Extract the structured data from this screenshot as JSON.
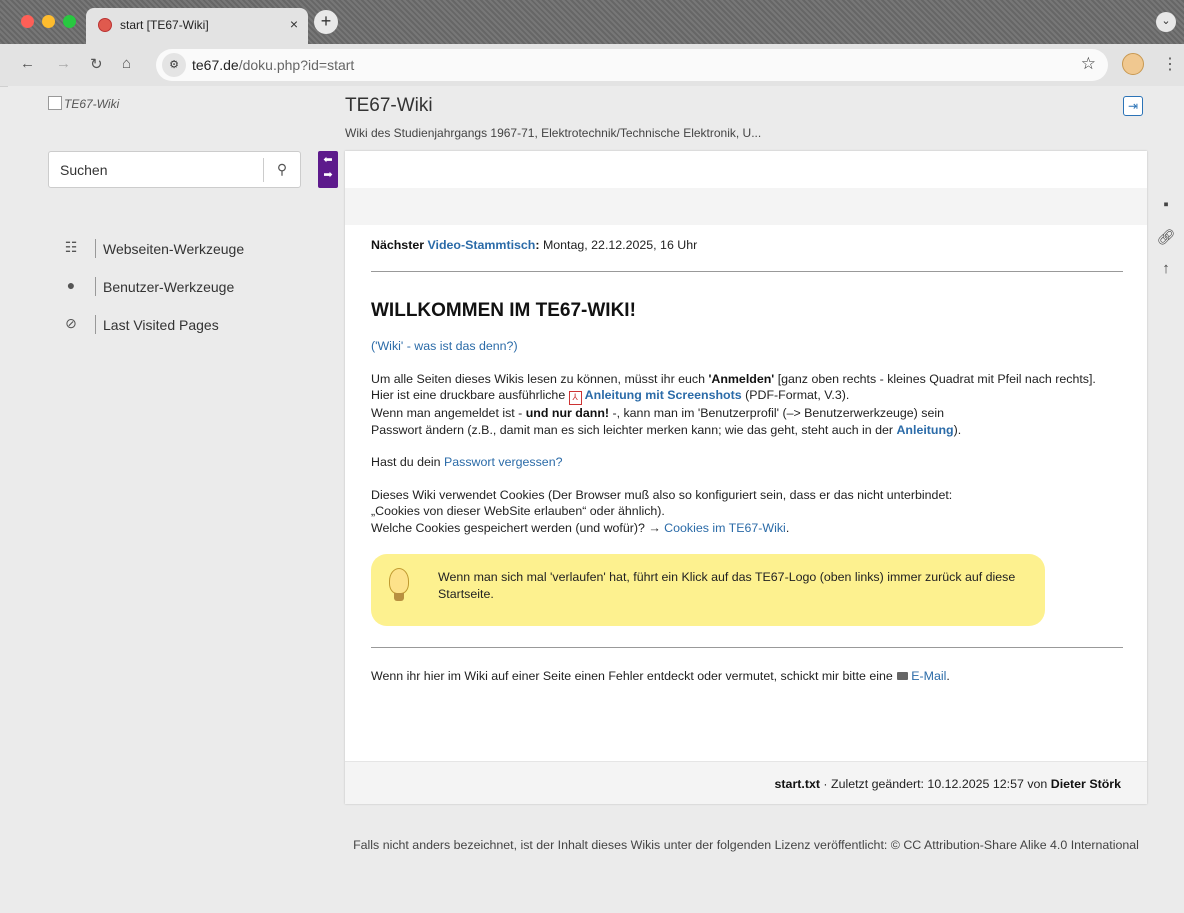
{
  "browser": {
    "tab_title": "start [TE67-Wiki]",
    "tab_close": "×",
    "new_tab": "+",
    "tab_menu": "⌄",
    "url_host": "te67.de",
    "url_path": "/doku.php?id=start"
  },
  "site": {
    "logo_alt": "TE67-Wiki",
    "title": "TE67-Wiki",
    "tagline": "Wiki des Studienjahrgangs 1967-71, Elektrotechnik/Technische Elektronik, U...",
    "search_placeholder": "Suchen"
  },
  "sidebar": {
    "items": [
      {
        "label": "Webseiten-Werkzeuge",
        "icon": "sitemap-icon"
      },
      {
        "label": "Benutzer-Werkzeuge",
        "icon": "user-icon"
      },
      {
        "label": "Last Visited Pages",
        "icon": "compass-icon"
      }
    ]
  },
  "content": {
    "next_label": "Nächster",
    "next_link": "Video-Stammtisch",
    "next_colon": ":",
    "next_date": " Montag, 22.12.2025, 16 Uhr",
    "heading": "WILLKOMMEN IM TE67-WIKI!",
    "wiki_link": "('Wiki' - was ist das denn?)",
    "p1_a": "Um alle Seiten dieses Wikis lesen zu können, müsst ihr euch ",
    "p1_b": "'Anmelden'",
    "p1_c": " [ganz oben rechts - kleines Quadrat mit Pfeil nach rechts].",
    "p2_a": "Hier ist eine druckbare ausführliche ",
    "p2_link": "Anleitung mit Screenshots",
    "p2_c": " (PDF-Format, V.3).",
    "p3_a": "Wenn man angemeldet ist - ",
    "p3_b": "und nur dann!",
    "p3_c": " -, kann man im 'Benutzerprofil' (–> Benutzerwerkzeuge) sein",
    "p4_a": "Passwort ändern (z.B., damit man es sich leichter merken kann; wie das geht, steht auch in der ",
    "p4_link": "Anleitung",
    "p4_c": ").",
    "pw_a": "Hast du dein ",
    "pw_link": "Passwort vergessen?",
    "cookie_1": "Dieses Wiki verwendet Cookies (Der Browser muß also so konfiguriert sein, dass er das nicht unterbindet:",
    "cookie_2": "„Cookies von dieser WebSite erlauben“ oder ähnlich).",
    "cookie_3": "Welche Cookies gespeichert werden (und wofür)? → ",
    "cookie_link": "Cookies im TE67-Wiki",
    "cookie_end": ".",
    "note": "Wenn man sich mal 'verlaufen' hat, führt ein Klick auf das TE67-Logo (oben links) immer zurück auf diese Startseite.",
    "error_a": "Wenn ihr hier im Wiki auf einer Seite einen Fehler entdeckt oder vermutet, schickt mir bitte eine ",
    "error_link": "E-Mail",
    "error_end": "."
  },
  "footer": {
    "file": "start.txt",
    "changed": " · Zuletzt geändert: 10.12.2025 12:57 von ",
    "author": "Dieter Störk",
    "license": "Falls nicht anders bezeichnet, ist der Inhalt dieses Wikis unter der folgenden Lizenz veröffentlicht: © CC Attribution-Share Alike 4.0 International"
  },
  "colors": {
    "accent_purple": "#5d1a8c",
    "link_blue": "#2b6ba8",
    "note_yellow": "#fdf18f"
  }
}
